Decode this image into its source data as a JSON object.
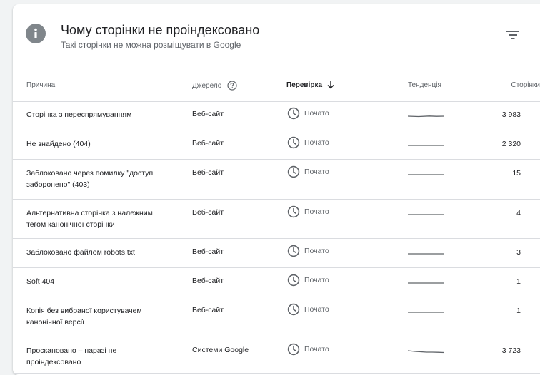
{
  "header": {
    "title": "Чому сторінки не проіндексовано",
    "subtitle": "Такі сторінки не можна розміщувати в Google"
  },
  "table": {
    "columns": {
      "reason": "Причина",
      "source": "Джерело",
      "check": "Перевірка",
      "trend": "Тенденція",
      "pages": "Сторінки"
    },
    "rows": [
      {
        "reason": "Сторінка з переспрямуванням",
        "source": "Веб-сайт",
        "status": "Почато",
        "pages": "3 983"
      },
      {
        "reason": "Не знайдено (404)",
        "source": "Веб-сайт",
        "status": "Почато",
        "pages": "2 320"
      },
      {
        "reason": "Заблоковано через помилку \"доступ заборонено\" (403)",
        "source": "Веб-сайт",
        "status": "Почато",
        "pages": "15"
      },
      {
        "reason": "Альтернативна сторінка з належним тегом канонічної сторінки",
        "source": "Веб-сайт",
        "status": "Почато",
        "pages": "4"
      },
      {
        "reason": "Заблоковано файлом robots.txt",
        "source": "Веб-сайт",
        "status": "Почато",
        "pages": "3"
      },
      {
        "reason": "Soft 404",
        "source": "Веб-сайт",
        "status": "Почато",
        "pages": "1"
      },
      {
        "reason": "Копія без вибраної користувачем канонічної версії",
        "source": "Веб-сайт",
        "status": "Почато",
        "pages": "1"
      },
      {
        "reason": "Проскановано – наразі не проіндексовано",
        "source": "Системи Google",
        "status": "Почато",
        "pages": "3 723"
      }
    ]
  },
  "icons": {
    "info": "info-icon",
    "filter": "filter-icon",
    "help": "help-icon",
    "sort": "arrow-down-icon",
    "status": "clock-icon",
    "trend": "sparkline-icon"
  },
  "colors": {
    "icon_gray": "#80868b",
    "text_secondary": "#5f6368",
    "divider": "#dadce0",
    "sparkline": "#5f6368"
  }
}
